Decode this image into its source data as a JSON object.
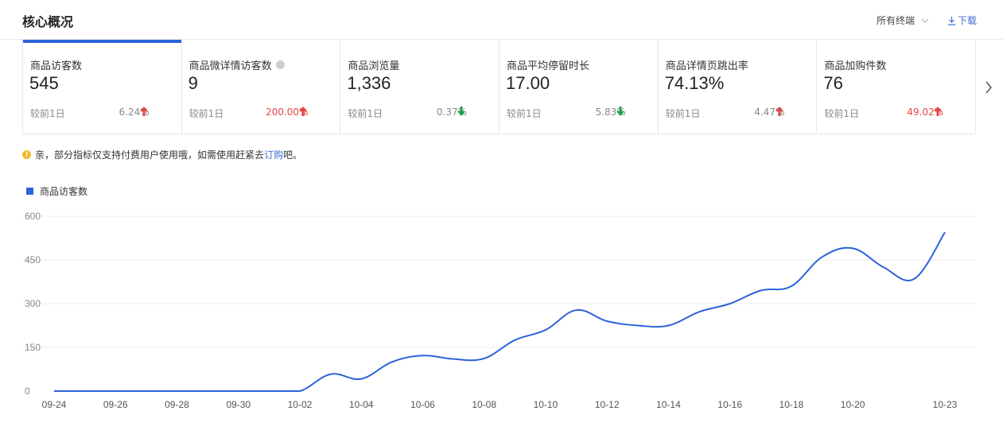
{
  "header": {
    "title": "核心概况",
    "terminal_select": "所有终端",
    "download_label": "下载"
  },
  "cards": [
    {
      "label": "商品访客数",
      "value": "545",
      "compare_label": "较前1日",
      "change": "6.24%",
      "direction": "up",
      "active": true
    },
    {
      "label": "商品微详情访客数",
      "value": "9",
      "compare_label": "较前1日",
      "change": "200.00%",
      "direction": "up",
      "highlight": true
    },
    {
      "label": "商品浏览量",
      "value": "1,336",
      "compare_label": "较前1日",
      "change": "0.37%",
      "direction": "down"
    },
    {
      "label": "商品平均停留时长",
      "value": "17.00",
      "compare_label": "较前1日",
      "change": "5.83%",
      "direction": "down"
    },
    {
      "label": "商品详情页跳出率",
      "value": "74.13%",
      "compare_label": "较前1日",
      "change": "4.47%",
      "direction": "up"
    },
    {
      "label": "商品加购件数",
      "value": "76",
      "compare_label": "较前1日",
      "change": "49.02%",
      "direction": "up",
      "highlight": true
    }
  ],
  "notice": {
    "text_before": "亲，部分指标仅支持付费用户使用哦，如需使用赶紧去 ",
    "link": "订购",
    "text_after": "吧。"
  },
  "colors": {
    "accent": "#2b63d9",
    "up_arrow": "#e64545",
    "down_arrow": "#1aa34a",
    "link": "#3f6fd1"
  },
  "chart_data": {
    "type": "line",
    "legend_position": "top-left",
    "grid": true,
    "ylim": [
      0,
      600
    ],
    "y_ticks": [
      0,
      150,
      300,
      450,
      600
    ],
    "x_tick_labels": [
      "09-24",
      "09-26",
      "09-28",
      "09-30",
      "10-02",
      "10-04",
      "10-06",
      "10-08",
      "10-10",
      "10-12",
      "10-14",
      "10-16",
      "10-18",
      "10-20",
      "10-23"
    ],
    "x": [
      "09-24",
      "09-25",
      "09-26",
      "09-27",
      "09-28",
      "09-29",
      "09-30",
      "10-01",
      "10-02",
      "10-03",
      "10-04",
      "10-05",
      "10-06",
      "10-07",
      "10-08",
      "10-09",
      "10-10",
      "10-11",
      "10-12",
      "10-13",
      "10-14",
      "10-15",
      "10-16",
      "10-17",
      "10-18",
      "10-19",
      "10-20",
      "10-21",
      "10-22",
      "10-23"
    ],
    "series": [
      {
        "name": "商品访客数",
        "values": [
          0,
          0,
          0,
          0,
          0,
          0,
          0,
          0,
          0,
          58,
          42,
          100,
          122,
          110,
          112,
          175,
          210,
          278,
          240,
          225,
          225,
          272,
          300,
          345,
          360,
          460,
          490,
          425,
          385,
          545
        ]
      }
    ]
  }
}
